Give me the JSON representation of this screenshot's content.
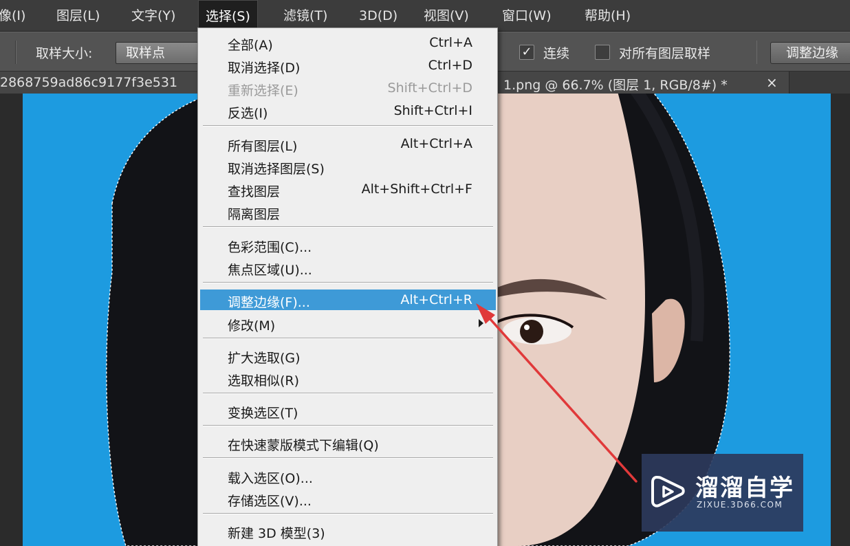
{
  "menubar": {
    "items": [
      {
        "label": "像(I)"
      },
      {
        "label": "图层(L)"
      },
      {
        "label": "文字(Y)"
      },
      {
        "label": "选择(S)",
        "active": true
      },
      {
        "label": "滤镜(T)"
      },
      {
        "label": "3D(D)"
      },
      {
        "label": "视图(V)"
      },
      {
        "label": "窗口(W)"
      },
      {
        "label": "帮助(H)"
      }
    ]
  },
  "options_bar": {
    "sample_size_label": "取样大小:",
    "sample_size_value": "取样点",
    "contiguous_label": "连续",
    "contiguous_checked": true,
    "all_layers_label": "对所有图层取样",
    "all_layers_checked": false,
    "refine_edge_button": "调整边缘"
  },
  "doc_tab": {
    "title_left": "2868759ad86c9177f3e531",
    "title_right": "1.png @ 66.7% (图层 1, RGB/8#) *",
    "close": "×"
  },
  "select_menu": {
    "items": [
      {
        "label": "全部(A)",
        "shortcut": "Ctrl+A"
      },
      {
        "label": "取消选择(D)",
        "shortcut": "Ctrl+D"
      },
      {
        "label": "重新选择(E)",
        "shortcut": "Shift+Ctrl+D",
        "disabled": true
      },
      {
        "label": "反选(I)",
        "shortcut": "Shift+Ctrl+I"
      },
      {
        "label": "所有图层(L)",
        "shortcut": "Alt+Ctrl+A"
      },
      {
        "label": "取消选择图层(S)",
        "shortcut": ""
      },
      {
        "label": "查找图层",
        "shortcut": "Alt+Shift+Ctrl+F"
      },
      {
        "label": "隔离图层",
        "shortcut": ""
      },
      {
        "label": "色彩范围(C)...",
        "shortcut": ""
      },
      {
        "label": "焦点区域(U)...",
        "shortcut": ""
      },
      {
        "label": "调整边缘(F)...",
        "shortcut": "Alt+Ctrl+R",
        "highlighted": true
      },
      {
        "label": "修改(M)",
        "shortcut": "",
        "submenu": true
      },
      {
        "label": "扩大选取(G)",
        "shortcut": ""
      },
      {
        "label": "选取相似(R)",
        "shortcut": ""
      },
      {
        "label": "变换选区(T)",
        "shortcut": ""
      },
      {
        "label": "在快速蒙版模式下编辑(Q)",
        "shortcut": ""
      },
      {
        "label": "载入选区(O)...",
        "shortcut": ""
      },
      {
        "label": "存储选区(V)...",
        "shortcut": ""
      },
      {
        "label": "新建 3D 模型(3)",
        "shortcut": ""
      }
    ]
  },
  "watermark": {
    "title": "溜溜自学",
    "subtitle": "ZIXUE.3D66.COM"
  },
  "colors": {
    "canvas_bg": "#1d9be0",
    "menu_highlight": "#3e9ad7",
    "annotation_arrow": "#e0393a",
    "hair": "#121317",
    "skin": "#e8cfc4"
  }
}
